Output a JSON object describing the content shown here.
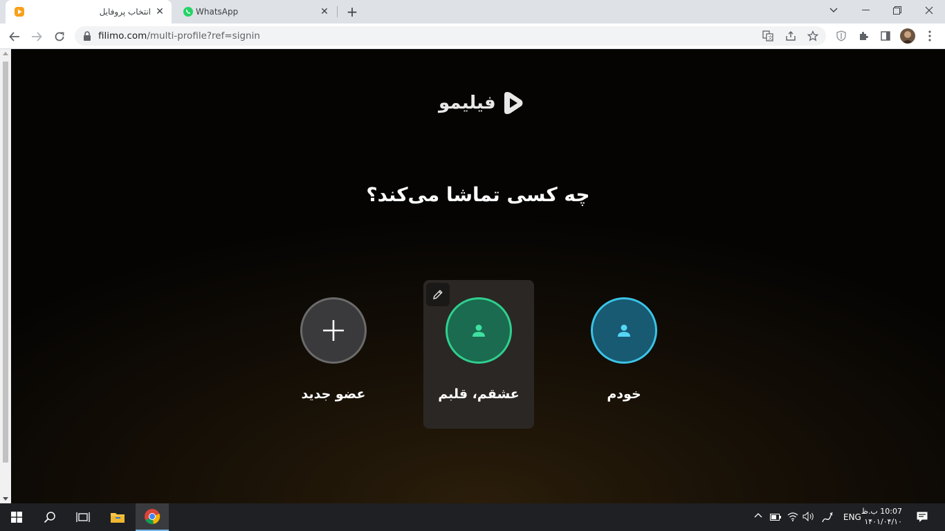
{
  "browser": {
    "tabs": [
      {
        "title": "انتخاب پروفایل",
        "favicon": "filimo-play-icon",
        "active": true
      },
      {
        "title": "WhatsApp",
        "favicon": "whatsapp-icon",
        "active": false
      }
    ],
    "url_host": "filimo.com",
    "url_path": "/multi-profile?ref=signin"
  },
  "page": {
    "brand": "فیلیمو",
    "heading": "چه کسی تماشا می‌کند؟",
    "profiles": [
      {
        "name": "عضو جدید",
        "kind": "add",
        "color": "#3a3a3c",
        "border": "#6b6b6b"
      },
      {
        "name": "عشقم، قلبم",
        "kind": "profile",
        "color": "#1a6b4f",
        "border": "#2fd08f",
        "selected": true
      },
      {
        "name": "خودم",
        "kind": "profile",
        "color": "#175a72",
        "border": "#3cc3e6"
      }
    ]
  },
  "taskbar": {
    "lang": "ENG",
    "time": "10:07 ب.ظ",
    "date": "۱۴۰۱/۰۴/۱۰"
  },
  "colors": {
    "accent_green": "#2fd08f",
    "accent_blue": "#3cc3e6"
  }
}
